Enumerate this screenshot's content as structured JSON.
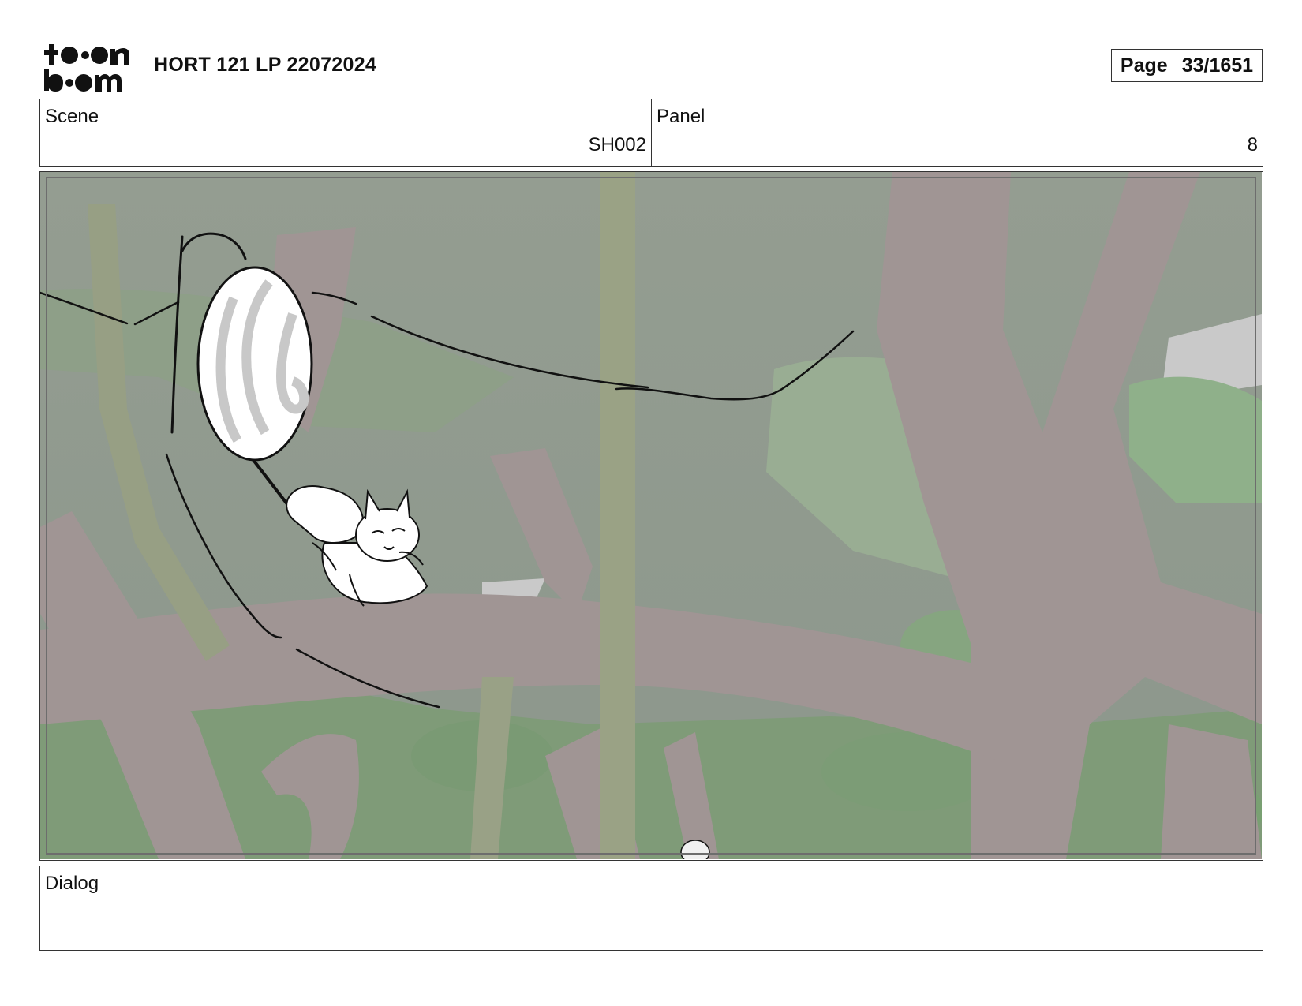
{
  "header": {
    "logo_text": "toon boom",
    "title": "HORT 121 LP 22072024",
    "page_label": "Page",
    "page_number": "33/1651"
  },
  "info": {
    "scene_label": "Scene",
    "scene_value": "SH002",
    "panel_label": "Panel",
    "panel_value": "8"
  },
  "dialog": {
    "label": "Dialog"
  },
  "colors": {
    "sky": "#929c90",
    "trunk": "#a09594",
    "foliage": "#8fa88a",
    "stalk": "#9aa285"
  }
}
